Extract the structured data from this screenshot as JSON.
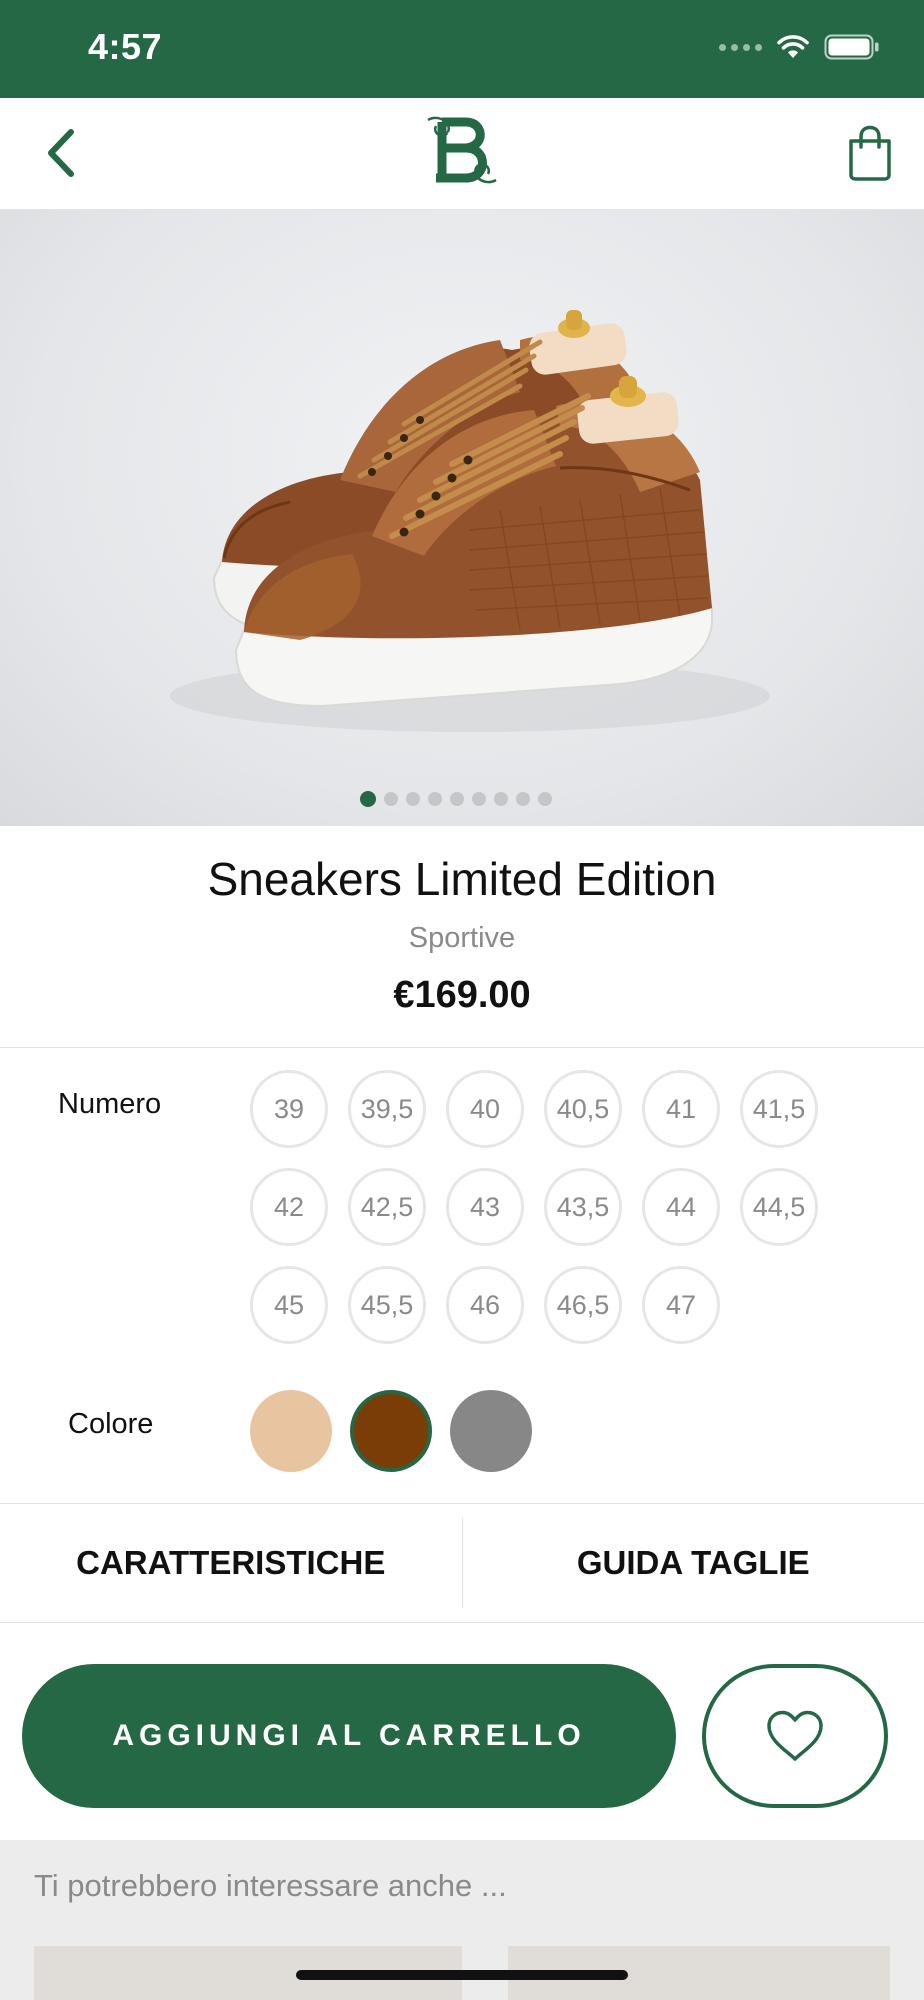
{
  "status_bar": {
    "time": "4:57"
  },
  "nav": {
    "back_icon": "chevron-left-icon",
    "logo_letter": "B",
    "bag_icon": "shopping-bag-icon"
  },
  "gallery": {
    "image_count": 9,
    "active_index": 0
  },
  "product": {
    "title": "Sneakers Limited Edition",
    "category": "Sportive",
    "price": "€169.00"
  },
  "sizes": {
    "label": "Numero",
    "options": [
      "39",
      "39,5",
      "40",
      "40,5",
      "41",
      "41,5",
      "42",
      "42,5",
      "43",
      "43,5",
      "44",
      "44,5",
      "45",
      "45,5",
      "46",
      "46,5",
      "47"
    ]
  },
  "colors": {
    "label": "Colore",
    "options": [
      "#e8c4a1",
      "#7a3d08",
      "#878787"
    ],
    "selected_index": 1
  },
  "tabs": [
    {
      "label": "CARATTERISTICHE"
    },
    {
      "label": "GUIDA TAGLIE"
    }
  ],
  "cta": {
    "add_to_cart": "AGGIUNGI AL CARRELLO",
    "wishlist_icon": "heart-icon"
  },
  "related": {
    "title": "Ti potrebbero interessare anche ..."
  },
  "theme": {
    "accent": "#256845"
  }
}
